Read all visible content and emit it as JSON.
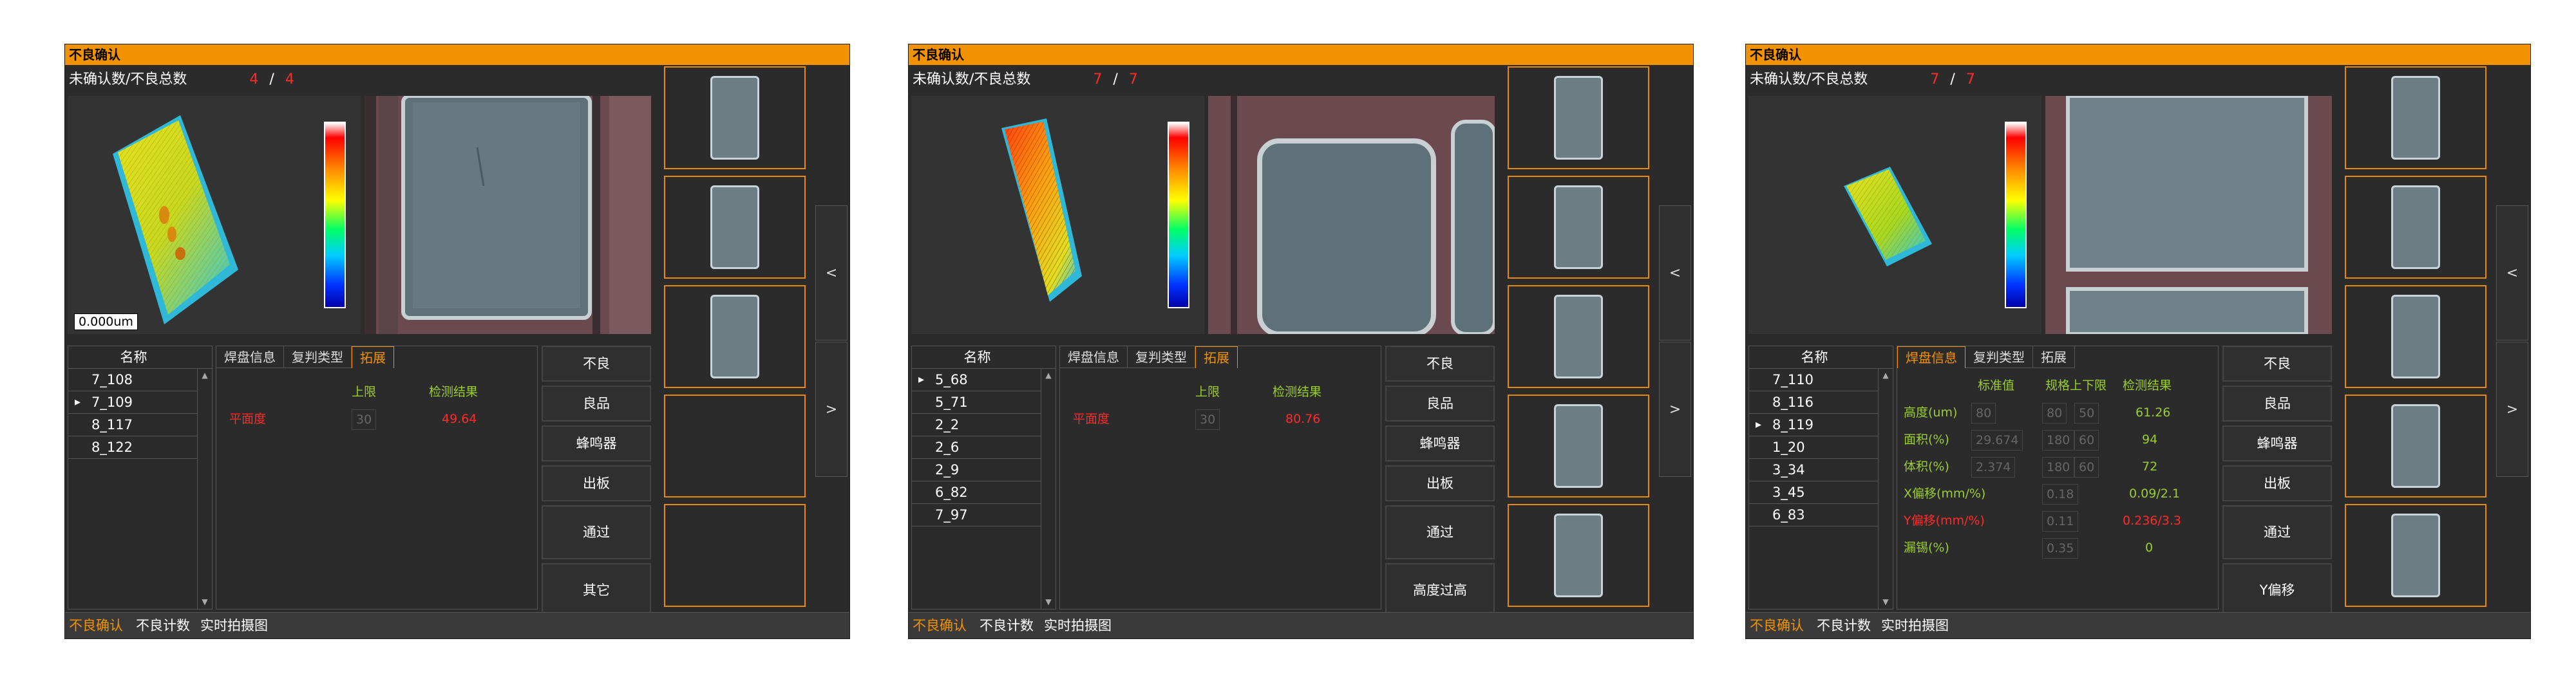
{
  "panels": [
    {
      "title": "不良确认",
      "count_label": "未确认数/不良总数",
      "unconfirmed": "4",
      "total": "4",
      "scale_label": "0.000um",
      "list_header": "名称",
      "list_items": [
        "7_108",
        "7_109",
        "8_117",
        "8_122"
      ],
      "selected_index": 1,
      "tabs": [
        "焊盘信息",
        "复判类型",
        "拓展"
      ],
      "active_tab": 2,
      "table_header": {
        "std": "",
        "limits": "上限",
        "result": "检测结果"
      },
      "rows": [
        {
          "name": "平面度",
          "std": "",
          "upper": "30",
          "lower": "",
          "result": "49.64",
          "ok": false
        }
      ],
      "buttons": [
        "不良",
        "良品",
        "蜂鸣器",
        "出板",
        "通过",
        "其它"
      ],
      "bottom_tabs": [
        "不良确认",
        "不良计数",
        "实时拍摄图"
      ],
      "nav_prev": "<",
      "nav_next": ">"
    },
    {
      "title": "不良确认",
      "count_label": "未确认数/不良总数",
      "unconfirmed": "7",
      "total": "7",
      "scale_label": "",
      "list_header": "名称",
      "list_items": [
        "5_68",
        "5_71",
        "2_2",
        "2_6",
        "2_9",
        "6_82",
        "7_97"
      ],
      "selected_index": 0,
      "tabs": [
        "焊盘信息",
        "复判类型",
        "拓展"
      ],
      "active_tab": 2,
      "table_header": {
        "std": "",
        "limits": "上限",
        "result": "检测结果"
      },
      "rows": [
        {
          "name": "平面度",
          "std": "",
          "upper": "30",
          "lower": "",
          "result": "80.76",
          "ok": false
        }
      ],
      "buttons": [
        "不良",
        "良品",
        "蜂鸣器",
        "出板",
        "通过",
        "高度过高"
      ],
      "bottom_tabs": [
        "不良确认",
        "不良计数",
        "实时拍摄图"
      ],
      "nav_prev": "<",
      "nav_next": ">"
    },
    {
      "title": "不良确认",
      "count_label": "未确认数/不良总数",
      "unconfirmed": "7",
      "total": "7",
      "scale_label": "",
      "list_header": "名称",
      "list_items": [
        "7_110",
        "8_116",
        "8_119",
        "1_20",
        "3_34",
        "3_45",
        "6_83"
      ],
      "selected_index": 2,
      "tabs": [
        "焊盘信息",
        "复判类型",
        "拓展"
      ],
      "active_tab": 0,
      "table_header": {
        "std": "标准值",
        "limits": "规格上下限",
        "result": "检测结果"
      },
      "rows": [
        {
          "name": "高度(um)",
          "std": "80",
          "upper": "80",
          "lower": "50",
          "result": "61.26",
          "ok": true
        },
        {
          "name": "面积(%)",
          "std": "29.674",
          "upper": "180",
          "lower": "60",
          "result": "94",
          "ok": true
        },
        {
          "name": "体积(%)",
          "std": "2.374",
          "upper": "180",
          "lower": "60",
          "result": "72",
          "ok": true
        },
        {
          "name": "X偏移(mm/%)",
          "std": "",
          "upper": "0.18",
          "lower": "",
          "result": "0.09/2.1",
          "ok": true
        },
        {
          "name": "Y偏移(mm/%)",
          "std": "",
          "upper": "0.11",
          "lower": "",
          "result": "0.236/3.3",
          "ok": false
        },
        {
          "name": "漏锡(%)",
          "std": "",
          "upper": "0.35",
          "lower": "",
          "result": "0",
          "ok": true
        }
      ],
      "buttons": [
        "不良",
        "良品",
        "蜂鸣器",
        "出板",
        "通过",
        "Y偏移"
      ],
      "bottom_tabs": [
        "不良确认",
        "不良计数",
        "实时拍摄图"
      ],
      "nav_prev": "<",
      "nav_next": ">"
    }
  ]
}
